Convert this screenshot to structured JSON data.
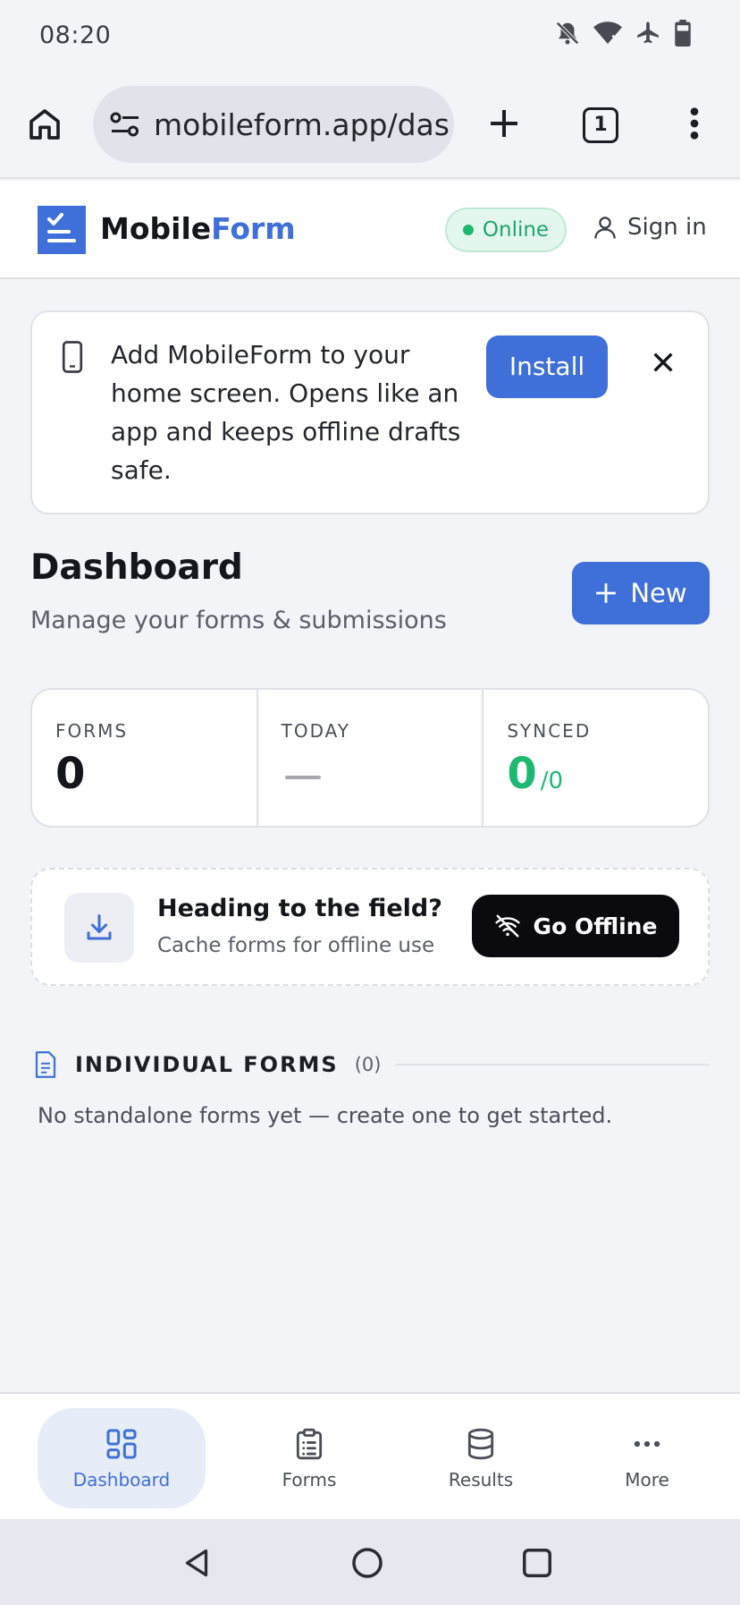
{
  "status_bar": {
    "time": "08:20"
  },
  "browser": {
    "url": "mobileform.app/das",
    "tab_count": "1"
  },
  "app_header": {
    "brand_main": "Mobile",
    "brand_accent": "Form",
    "status": "Online",
    "sign_in": "Sign in"
  },
  "install_banner": {
    "message": "Add MobileForm to your home screen. Opens like an app and keeps offline drafts safe.",
    "install_label": "Install"
  },
  "dashboard": {
    "title": "Dashboard",
    "subtitle": "Manage your forms & submissions",
    "new_label": "New"
  },
  "stats": {
    "forms_label": "FORMS",
    "forms_value": "0",
    "today_label": "TODAY",
    "synced_label": "SYNCED",
    "synced_value": "0",
    "synced_total": "/0"
  },
  "offline_card": {
    "heading": "Heading to the field?",
    "subtext": "Cache forms for offline use",
    "button_label": "Go Offline"
  },
  "individual_forms": {
    "title": "INDIVIDUAL FORMS",
    "count": "(0)",
    "empty_message": "No standalone forms yet — create one to get started."
  },
  "bottom_nav": {
    "items": [
      {
        "label": "Dashboard",
        "icon": "grid-icon",
        "active": true
      },
      {
        "label": "Forms",
        "icon": "clipboard-icon",
        "active": false
      },
      {
        "label": "Results",
        "icon": "database-icon",
        "active": false
      },
      {
        "label": "More",
        "icon": "more-dots-icon",
        "active": false
      }
    ]
  },
  "colors": {
    "accent": "#3f6fd8",
    "success": "#1db972",
    "background": "#f3f4f8"
  }
}
